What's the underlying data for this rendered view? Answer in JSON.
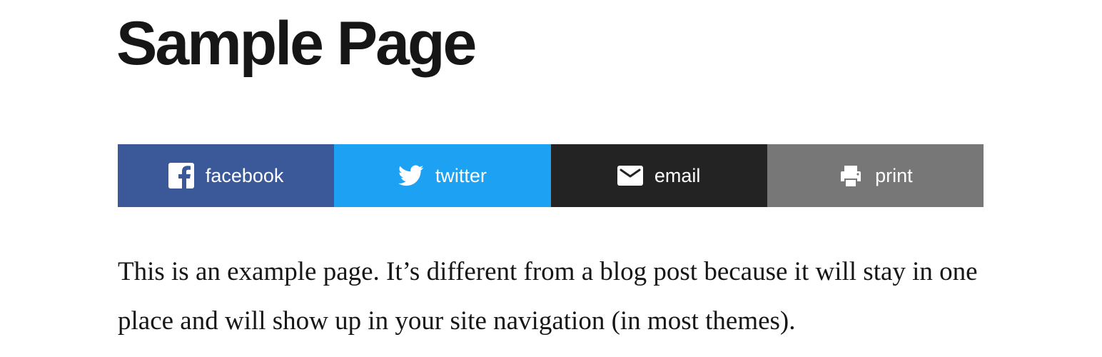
{
  "page": {
    "title": "Sample Page"
  },
  "share": {
    "buttons": [
      {
        "id": "facebook",
        "label": "facebook",
        "icon": "facebook-icon",
        "color": "#3b5998"
      },
      {
        "id": "twitter",
        "label": "twitter",
        "icon": "twitter-icon",
        "color": "#1da1f2"
      },
      {
        "id": "email",
        "label": "email",
        "icon": "envelope-icon",
        "color": "#232323"
      },
      {
        "id": "print",
        "label": "print",
        "icon": "printer-icon",
        "color": "#777777"
      }
    ]
  },
  "content": {
    "paragraph": "This is an example page. It’s different from a blog post because it will stay in one place and will show up in your site navigation (in most themes)."
  }
}
